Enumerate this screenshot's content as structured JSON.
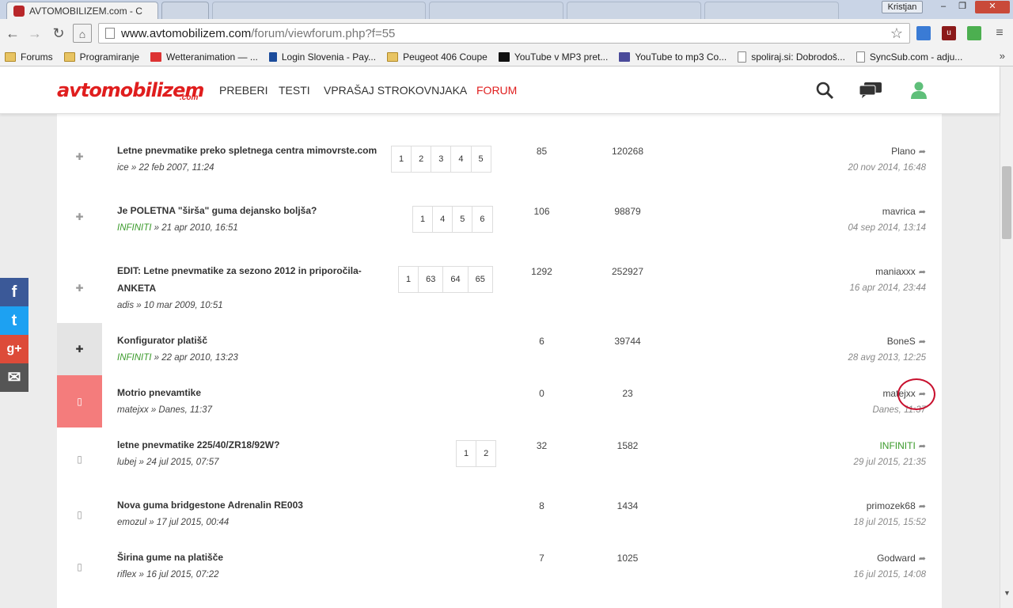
{
  "browser": {
    "tabs": [
      {
        "title": "AVTOMOBILIZEM.com - C",
        "active": true
      },
      {
        "title": "",
        "active": false
      }
    ],
    "user": "Kristjan",
    "url_host": "www.avtomobilizem.com",
    "url_path": "/forum/viewforum.php?f=55",
    "bookmarks": [
      {
        "label": "Forums",
        "icon": "folder"
      },
      {
        "label": "Programiranje",
        "icon": "folder"
      },
      {
        "label": "Wetteranimation — ...",
        "icon": "weather"
      },
      {
        "label": "Login Slovenia - Pay...",
        "icon": "paypal"
      },
      {
        "label": "Peugeot 406 Coupe",
        "icon": "folder"
      },
      {
        "label": "YouTube v MP3 pret...",
        "icon": "youtube-mp3"
      },
      {
        "label": "YouTube to mp3 Co...",
        "icon": "yt-mp3"
      },
      {
        "label": "spoliraj.si: Dobrodoš...",
        "icon": "page"
      },
      {
        "label": "SyncSub.com - adju...",
        "icon": "page"
      }
    ],
    "bookmarks_more": "»"
  },
  "site": {
    "logo": "avtomobilizem",
    "logo_suffix": ".com",
    "nav": [
      "PREBERI",
      "TESTI",
      "VPRAŠAJ STROKOVNJAKA",
      "FORUM"
    ],
    "active_nav": "FORUM"
  },
  "topics": [
    {
      "title": "Letne pnevmatike preko spletnega centra mimovrste.com",
      "author": "ice",
      "author_green": false,
      "date": "22 feb 2007, 11:24",
      "pages": [
        "1",
        "2",
        "3",
        "4",
        "5"
      ],
      "replies": "85",
      "views": "120268",
      "last_user": "Plano",
      "last_user_green": false,
      "last_date": "20 nov 2014, 16:48",
      "icon": "pin-icon",
      "state": "normal"
    },
    {
      "title": "Je POLETNA \"širša\" guma dejansko boljša?",
      "author": "INFINITI",
      "author_green": true,
      "date": "21 apr 2010, 16:51",
      "pages": [
        "1",
        "4",
        "5",
        "6"
      ],
      "replies": "106",
      "views": "98879",
      "last_user": "mavrica",
      "last_user_green": false,
      "last_date": "04 sep 2014, 13:14",
      "icon": "pin-icon",
      "state": "normal"
    },
    {
      "title": "EDIT: Letne pnevmatike za sezono 2012 in priporočila-ANKETA",
      "author": "adis",
      "author_green": false,
      "date": "10 mar 2009, 10:51",
      "pages": [
        "1",
        "63",
        "64",
        "65"
      ],
      "replies": "1292",
      "views": "252927",
      "last_user": "maniaxxx",
      "last_user_green": false,
      "last_date": "16 apr 2014, 23:44",
      "icon": "pin-icon",
      "state": "normal"
    },
    {
      "title": "Konfigurator platišč",
      "author": "INFINITI",
      "author_green": true,
      "date": "22 apr 2010, 13:23",
      "pages": [],
      "replies": "6",
      "views": "39744",
      "last_user": "BoneS",
      "last_user_green": false,
      "last_date": "28 avg 2013, 12:25",
      "icon": "pin-icon",
      "state": "hover"
    },
    {
      "title": "Motrio pnevamtike",
      "author": "matejxx",
      "author_green": false,
      "date": "Danes, 11:37",
      "pages": [],
      "replies": "0",
      "views": "23",
      "last_user": "matejxx",
      "last_user_green": false,
      "last_date": "Danes, 11:37",
      "icon": "document-icon",
      "state": "new"
    },
    {
      "title": "letne pnevmatike 225/40/ZR18/92W?",
      "author": "lubej",
      "author_green": false,
      "date": "24 jul 2015, 07:57",
      "pages": [
        "1",
        "2"
      ],
      "replies": "32",
      "views": "1582",
      "last_user": "INFINITI",
      "last_user_green": true,
      "last_date": "29 jul 2015, 21:35",
      "icon": "document-icon",
      "state": "normal"
    },
    {
      "title": "Nova guma bridgestone Adrenalin RE003",
      "author": "emozul",
      "author_green": false,
      "date": "17 jul 2015, 00:44",
      "pages": [],
      "replies": "8",
      "views": "1434",
      "last_user": "primozek68",
      "last_user_green": false,
      "last_date": "18 jul 2015, 15:52",
      "icon": "document-icon",
      "state": "normal"
    },
    {
      "title": "Širina gume na platišče",
      "author": "riflex",
      "author_green": false,
      "date": "16 jul 2015, 07:22",
      "pages": [],
      "replies": "7",
      "views": "1025",
      "last_user": "Godward",
      "last_user_green": false,
      "last_date": "16 jul 2015, 14:08",
      "icon": "document-icon",
      "state": "normal"
    }
  ],
  "colors": {
    "brand": "#e01e1e",
    "new_topic": "#f47c7c",
    "green_user": "#3a9a2a",
    "facebook": "#3b5998",
    "twitter": "#1da1f2",
    "googleplus": "#dd4b39",
    "email": "#555555"
  },
  "social": [
    {
      "name": "facebook",
      "glyph": "f"
    },
    {
      "name": "twitter",
      "glyph": "t"
    },
    {
      "name": "googleplus",
      "glyph": "g+"
    },
    {
      "name": "email",
      "glyph": "✉"
    }
  ]
}
